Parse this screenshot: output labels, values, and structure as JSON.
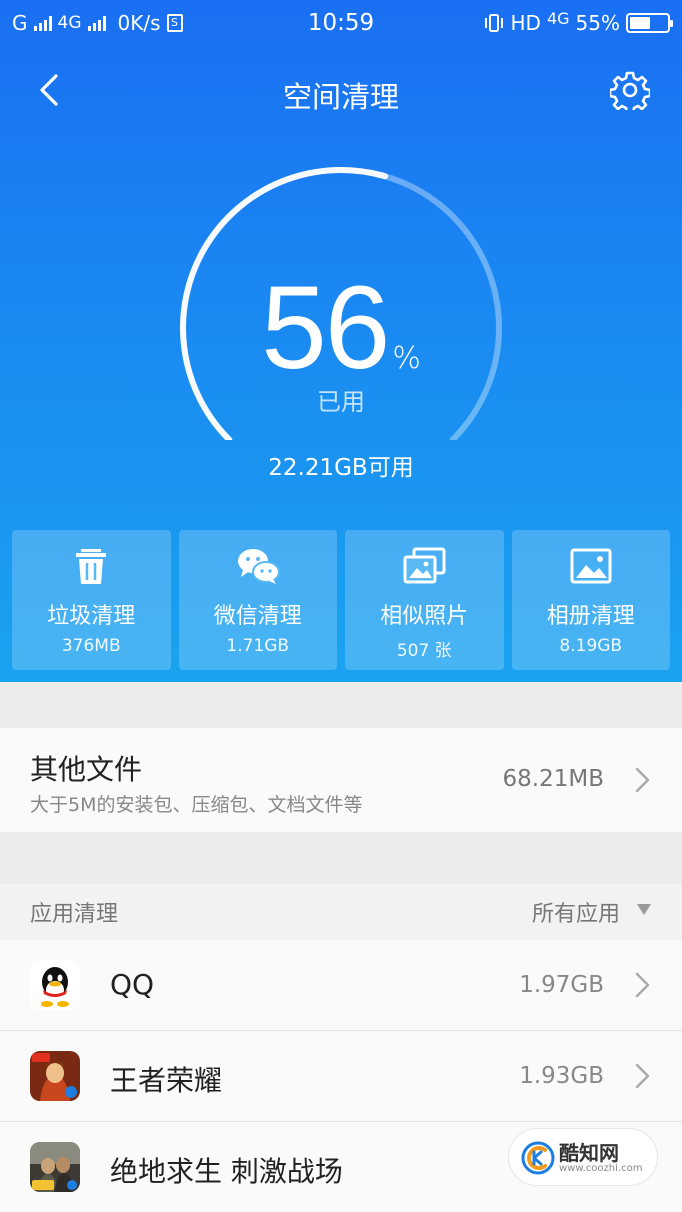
{
  "status_bar": {
    "network_left": "G",
    "network_4g": "4G",
    "speed": "0K/s",
    "time": "10:59",
    "hd": "HD",
    "network_right": "4G",
    "battery_text": "55%",
    "battery_level": 0.55
  },
  "header": {
    "title": "空间清理"
  },
  "storage": {
    "used_percent_value": "56",
    "percent_sign": "%",
    "used_label": "已用",
    "used_fraction": 0.56,
    "available_text": "22.21GB可用"
  },
  "tiles": [
    {
      "label": "垃圾清理",
      "value": "376MB",
      "icon": "trash-icon"
    },
    {
      "label": "微信清理",
      "value": "1.71GB",
      "icon": "wechat-icon"
    },
    {
      "label": "相似照片",
      "value": "507 张",
      "icon": "similar-photos-icon"
    },
    {
      "label": "相册清理",
      "value": "8.19GB",
      "icon": "album-icon"
    }
  ],
  "other_files": {
    "title": "其他文件",
    "description": "大于5M的安装包、压缩包、文档文件等",
    "size": "68.21MB"
  },
  "app_cleanup": {
    "title": "应用清理",
    "filter": "所有应用",
    "apps": [
      {
        "name": "QQ",
        "size": "1.97GB",
        "icon": "qq-icon"
      },
      {
        "name": "王者荣耀",
        "size": "1.93GB",
        "icon": "honor-of-kings-icon"
      },
      {
        "name": "绝地求生 刺激战场",
        "size": "",
        "icon": "pubg-icon"
      }
    ]
  },
  "watermark": {
    "text": "酷知网",
    "url": "www.coozhi.com"
  },
  "colors": {
    "hero_top": "#1a6ff2",
    "hero_bottom": "#1aa3f0",
    "background": "#f2f2f2"
  }
}
